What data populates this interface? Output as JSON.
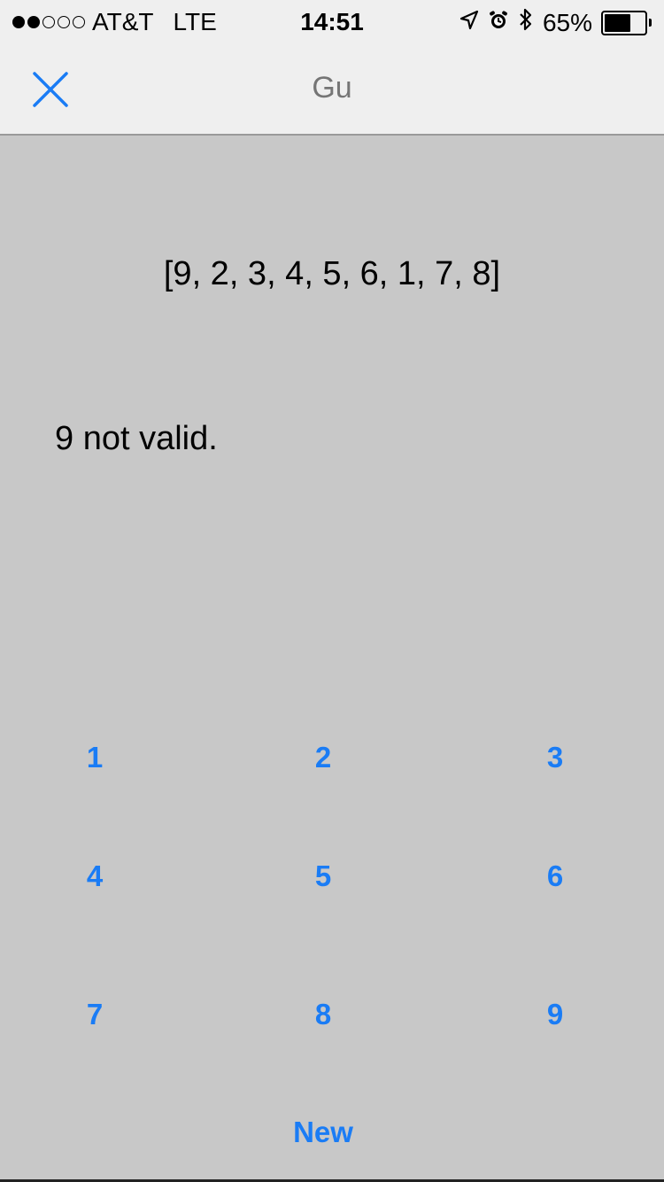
{
  "status_bar": {
    "signal_full": 2,
    "signal_total": 5,
    "carrier": "AT&T",
    "network": "LTE",
    "time": "14:51",
    "icons": [
      "location-arrow-icon",
      "alarm-icon",
      "bluetooth-icon"
    ],
    "battery_percent": "65%",
    "battery_level": 0.65
  },
  "nav": {
    "close_icon": "close-icon",
    "title": "Gu"
  },
  "sequence_text": "[9, 2, 3, 4, 5, 6, 1, 7, 8]",
  "message": "9 not valid.",
  "keypad": {
    "keys": [
      "1",
      "2",
      "3",
      "4",
      "5",
      "6",
      "7",
      "8",
      "9"
    ],
    "new_label": "New"
  },
  "colors": {
    "accent": "#1a7cf5",
    "background": "#c8c8c8",
    "bar": "#efefef"
  }
}
